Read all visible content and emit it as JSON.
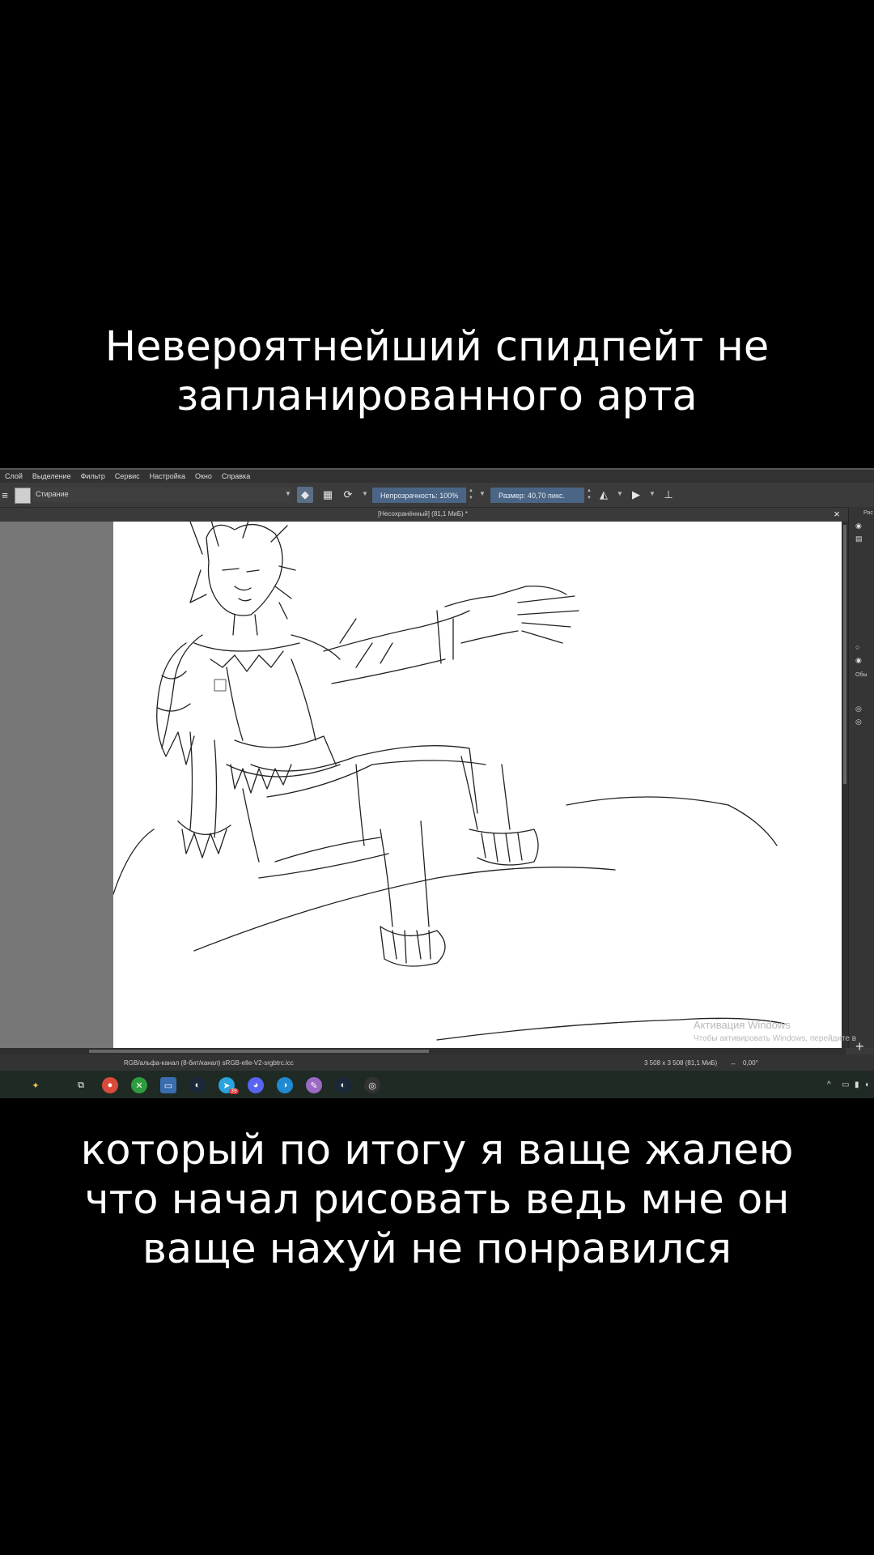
{
  "captions": {
    "top": [
      "Невероятнейший спидпейт не",
      "запланированного арта"
    ],
    "bottom": [
      "который по итогу я ваще жалею",
      "что начал рисовать ведь мне он",
      "ваще нахуй не понравился"
    ]
  },
  "app": {
    "menu": [
      "Слой",
      "Выделение",
      "Фильтр",
      "Сервис",
      "Настройка",
      "Окно",
      "Справка"
    ],
    "toolbar": {
      "brush_preset": "Стирание",
      "opacity": "Непрозрачность: 100%",
      "size": "Размер: 40,70 пикс."
    },
    "document_tab": "[Несохранённый]  (81,1 МиБ) *",
    "status": {
      "color_profile": "RGB/альфа-канал (8-бит/канал)  sRGB-elle-V2-srgbtrc.icc",
      "dimensions": "3 508 x 3 508 (81,1 МиБ)",
      "rotation": "0,00°"
    },
    "watermark": {
      "title": "Активация Windows",
      "subtitle": "Чтобы активировать Windows, перейдите в"
    },
    "dock": {
      "tab": "Рас",
      "layer_mode": "Обы"
    }
  },
  "taskbar": {
    "icons": [
      "copilot-icon",
      "taskview-icon",
      "chrome-icon",
      "xbox-icon",
      "explorer-icon",
      "steam-icon",
      "telegram-icon",
      "discord-icon",
      "edge-icon",
      "krita-icon",
      "steam-icon",
      "obs-icon"
    ],
    "badge": "39"
  },
  "colors": {
    "background": "#000000",
    "canvas": "#ffffff",
    "ui_panel": "#3a3a3a",
    "accent": "#4a6585"
  }
}
